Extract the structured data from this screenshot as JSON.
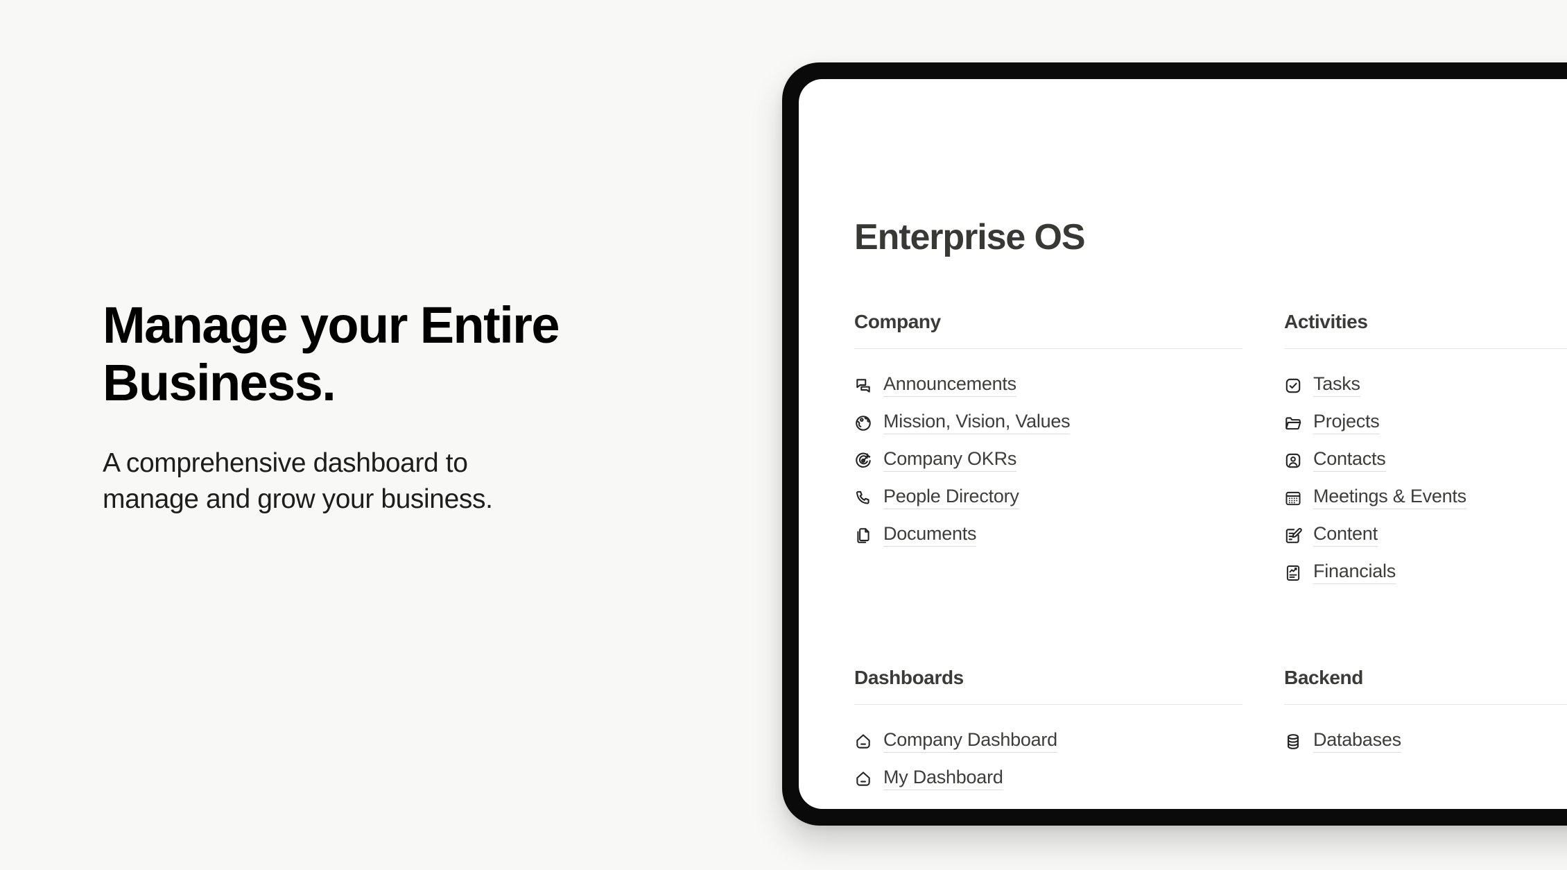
{
  "hero": {
    "title": "Manage your Entire\nBusiness.",
    "subtitle": "A comprehensive dashboard to\nmanage and grow your business."
  },
  "app": {
    "title": "Enterprise OS"
  },
  "colors": {
    "page_background": "#f8f8f7",
    "device_bezel": "#0a0a0a",
    "screen": "#ffffff",
    "heading": "#000000",
    "app_title": "#383835",
    "section_title": "#3a3a38",
    "link_label": "#3d3d3b",
    "rule": "#e6e6e4",
    "underline": "#dcdcda"
  },
  "sections": [
    {
      "key": "company",
      "title": "Company",
      "items": [
        {
          "label": "Announcements",
          "icon": "announcements-icon"
        },
        {
          "label": "Mission, Vision, Values",
          "icon": "globe-icon"
        },
        {
          "label": "Company OKRs",
          "icon": "target-icon"
        },
        {
          "label": "People Directory",
          "icon": "phone-icon"
        },
        {
          "label": "Documents",
          "icon": "documents-icon"
        }
      ]
    },
    {
      "key": "activities",
      "title": "Activities",
      "items": [
        {
          "label": "Tasks",
          "icon": "check-square-icon"
        },
        {
          "label": "Projects",
          "icon": "folder-icon"
        },
        {
          "label": "Contacts",
          "icon": "contact-card-icon"
        },
        {
          "label": "Meetings & Events",
          "icon": "calendar-icon"
        },
        {
          "label": "Content",
          "icon": "edit-document-icon"
        },
        {
          "label": "Financials",
          "icon": "financial-report-icon"
        }
      ]
    },
    {
      "key": "dashboards",
      "title": "Dashboards",
      "items": [
        {
          "label": "Company Dashboard",
          "icon": "home-icon"
        },
        {
          "label": "My Dashboard",
          "icon": "home-icon"
        }
      ]
    },
    {
      "key": "backend",
      "title": "Backend",
      "items": [
        {
          "label": "Databases",
          "icon": "database-icon"
        }
      ]
    }
  ]
}
